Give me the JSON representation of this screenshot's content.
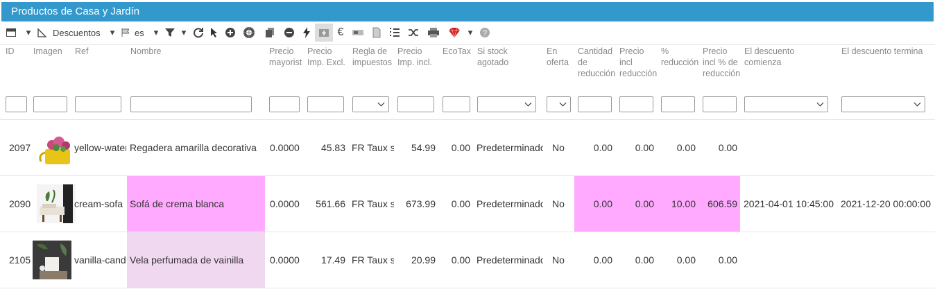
{
  "title": "Productos de Casa y Jardín",
  "toolbar": {
    "discounts_label": "Descuentos",
    "lang_label": "es"
  },
  "headers": {
    "id": "ID",
    "image": "Imagen",
    "ref": "Ref",
    "name": "Nombre",
    "wholesale": [
      "Precio",
      "mayorist"
    ],
    "price_excl": [
      "Precio",
      "Imp. Excl."
    ],
    "tax_rule": [
      "Regla de",
      "impuestos"
    ],
    "price_incl": [
      "Precio",
      "Imp. incl."
    ],
    "ecotax": "EcoTax",
    "out_of_stock": [
      "Si stock",
      "agotado"
    ],
    "on_sale": [
      "En",
      "oferta"
    ],
    "reduction_qty": [
      "Cantidad",
      "de",
      "reducción"
    ],
    "reduction_price": [
      "Precio",
      "incl",
      "reducción"
    ],
    "reduction_pct": [
      "%",
      "reducción"
    ],
    "price_pct": [
      "Precio",
      "incl % de",
      "reducción"
    ],
    "discount_start": [
      "El descuento",
      "comienza"
    ],
    "discount_end": "El descuento termina"
  },
  "rows": [
    {
      "id": "2097",
      "ref": "yellow-watering-can",
      "name": "Regadera amarilla decorativa",
      "wholesale": "0.0000",
      "price_excl": "45.83",
      "tax_rule": "FR Taux standard",
      "price_incl": "54.99",
      "ecotax": "0.00",
      "out_of_stock": "Predeterminado",
      "on_sale": "No",
      "red_qty": "0.00",
      "red_price": "0.00",
      "red_pct": "0.00",
      "price_pct": "0.00",
      "start": "",
      "end": "",
      "image": "yellow-watering-can-with-flowers"
    },
    {
      "id": "2090",
      "ref": "cream-sofa",
      "name": "Sofá de crema blanca",
      "wholesale": "0.0000",
      "price_excl": "561.66",
      "tax_rule": "FR Taux standard",
      "price_incl": "673.99",
      "ecotax": "0.00",
      "out_of_stock": "Predeterminado",
      "on_sale": "No",
      "red_qty": "0.00",
      "red_price": "0.00",
      "red_pct": "10.00",
      "price_pct": "606.59",
      "start": "2021-04-01 10:45:00",
      "end": "2021-12-20 00:00:00",
      "image": "cream-sofa-room"
    },
    {
      "id": "2105",
      "ref": "vanilla-candle",
      "name": "Vela perfumada de vainilla",
      "wholesale": "0.0000",
      "price_excl": "17.49",
      "tax_rule": "FR Taux standard",
      "price_incl": "20.99",
      "ecotax": "0.00",
      "out_of_stock": "Predeterminado",
      "on_sale": "No",
      "red_qty": "0.00",
      "red_price": "0.00",
      "red_pct": "0.00",
      "price_pct": "0.00",
      "start": "",
      "end": "",
      "image": "vanilla-candle-flowers"
    }
  ],
  "colors": {
    "title_bar": "#3399cc",
    "highlight": "#ffaaff",
    "highlight_soft": "#f0d8f0"
  }
}
